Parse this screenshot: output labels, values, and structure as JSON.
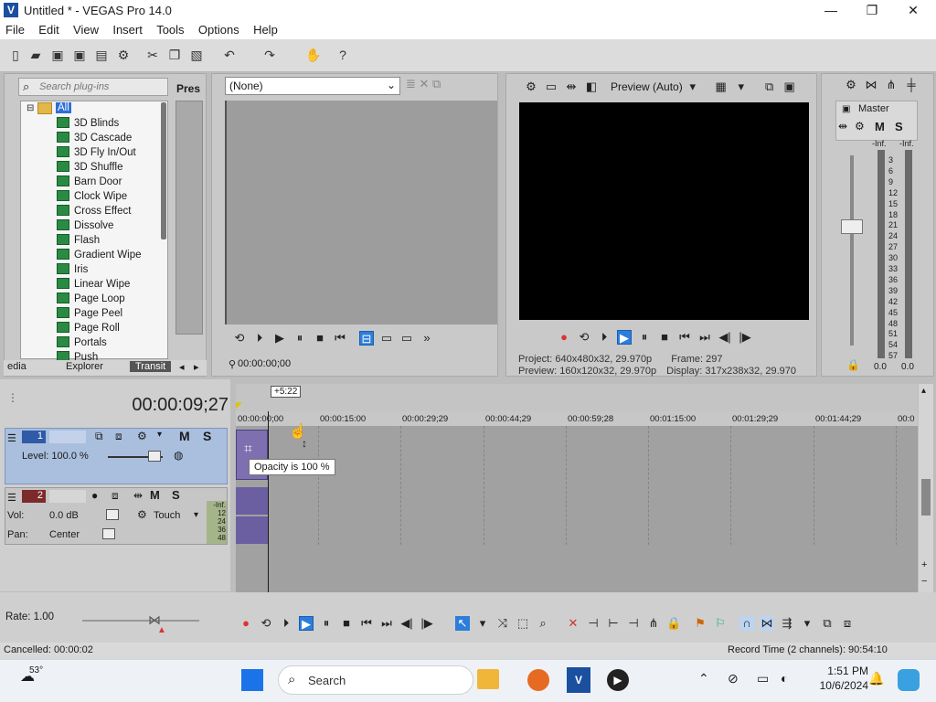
{
  "window": {
    "title": "Untitled * - VEGAS Pro 14.0",
    "min": "—",
    "max": "❐",
    "close": "✕"
  },
  "menu": [
    "File",
    "Edit",
    "View",
    "Insert",
    "Tools",
    "Options",
    "Help"
  ],
  "plugins": {
    "search_placeholder": "Search plug-ins",
    "presets_label": "Pres",
    "root": "All",
    "items": [
      "3D Blinds",
      "3D Cascade",
      "3D Fly In/Out",
      "3D Shuffle",
      "Barn Door",
      "Clock Wipe",
      "Cross Effect",
      "Dissolve",
      "Flash",
      "Gradient Wipe",
      "Iris",
      "Linear Wipe",
      "Page Loop",
      "Page Peel",
      "Page Roll",
      "Portals",
      "Push"
    ],
    "tabs": [
      "edia",
      "Explorer",
      "Transit"
    ]
  },
  "trimmer": {
    "select": "(None)",
    "time": "00:00:00;00"
  },
  "preview": {
    "quality": "Preview (Auto)",
    "project_label": "Project:",
    "project": "640x480x32, 29.970p",
    "preview_label": "Preview:",
    "preview_val": "160x120x32, 29.970p",
    "frame_label": "Frame:",
    "frame": "297",
    "display_label": "Display:",
    "display": "317x238x32, 29.970"
  },
  "master": {
    "title": "Master",
    "inf_left": "-Inf.",
    "inf_right": "-Inf.",
    "scale": [
      "3",
      "6",
      "9",
      "12",
      "15",
      "18",
      "21",
      "24",
      "27",
      "30",
      "33",
      "36",
      "39",
      "42",
      "45",
      "48",
      "51",
      "54",
      "57"
    ],
    "bottom_left": "0.0",
    "bottom_right": "0.0"
  },
  "timeline": {
    "time": "00:00:09;27",
    "offset": "+5:22",
    "ticks": [
      "00:00:00;00",
      "00:00:15:00",
      "00:00:29;29",
      "00:00:44;29",
      "00:00:59;28",
      "00:01:15:00",
      "00:01:29;29",
      "00:01:44;29",
      "00:0"
    ],
    "track1": {
      "num": "1",
      "level": "Level: 100.0 %",
      "m": "M",
      "s": "S"
    },
    "track2": {
      "num": "2",
      "vol_label": "Vol:",
      "vol": "0.0 dB",
      "pan_label": "Pan:",
      "pan": "Center",
      "touch": "Touch",
      "m": "M",
      "s": "S",
      "meter": [
        "-Inf.",
        "12",
        "24",
        "36",
        "48"
      ]
    },
    "tooltip": "Opacity is 100 %"
  },
  "bottom": {
    "rate": "Rate: 1.00",
    "status": "Cancelled: 00:00:02",
    "record": "Record Time (2 channels): 90:54:10"
  },
  "taskbar": {
    "temp": "53°",
    "search": "Search",
    "time": "1:51 PM",
    "date": "10/6/2024"
  }
}
